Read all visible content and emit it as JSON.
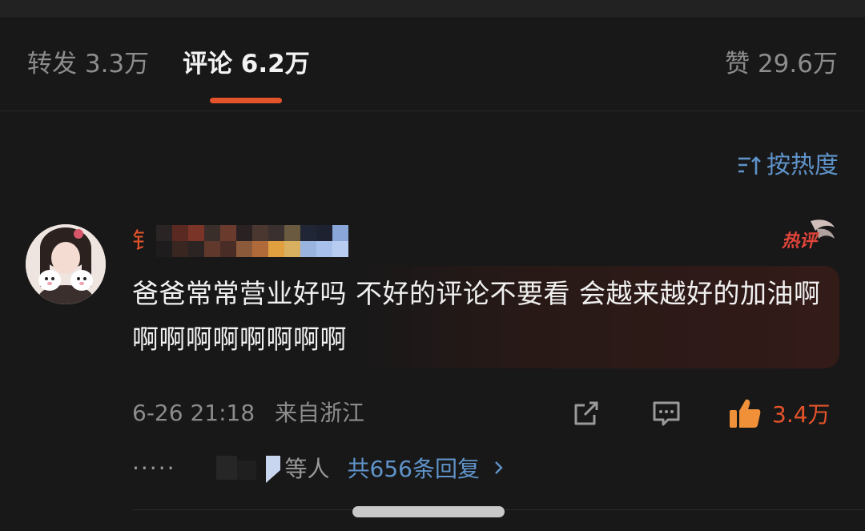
{
  "tabs": {
    "reposts": "转发 3.3万",
    "comments": "评论 6.2万",
    "likes": "赞 29.6万"
  },
  "sort": {
    "label": "按热度",
    "icon": "sort-icon"
  },
  "comment": {
    "username_visible": "钅",
    "hot_badge_text": "热评",
    "text": "爸爸常常营业好吗 不好的评论不要看 会越来越好的加油啊啊啊啊啊啊啊啊啊",
    "date": "6-26 21:18",
    "location": "来自浙江",
    "like_count": "3.4万",
    "reply_person_suffix": "等人",
    "reply_total": "共656条回复",
    "ellipsis": "·····"
  },
  "colors": {
    "background": "#181818",
    "accent": "#e5532a",
    "link": "#5f93c9",
    "muted": "#8c8c8c"
  }
}
